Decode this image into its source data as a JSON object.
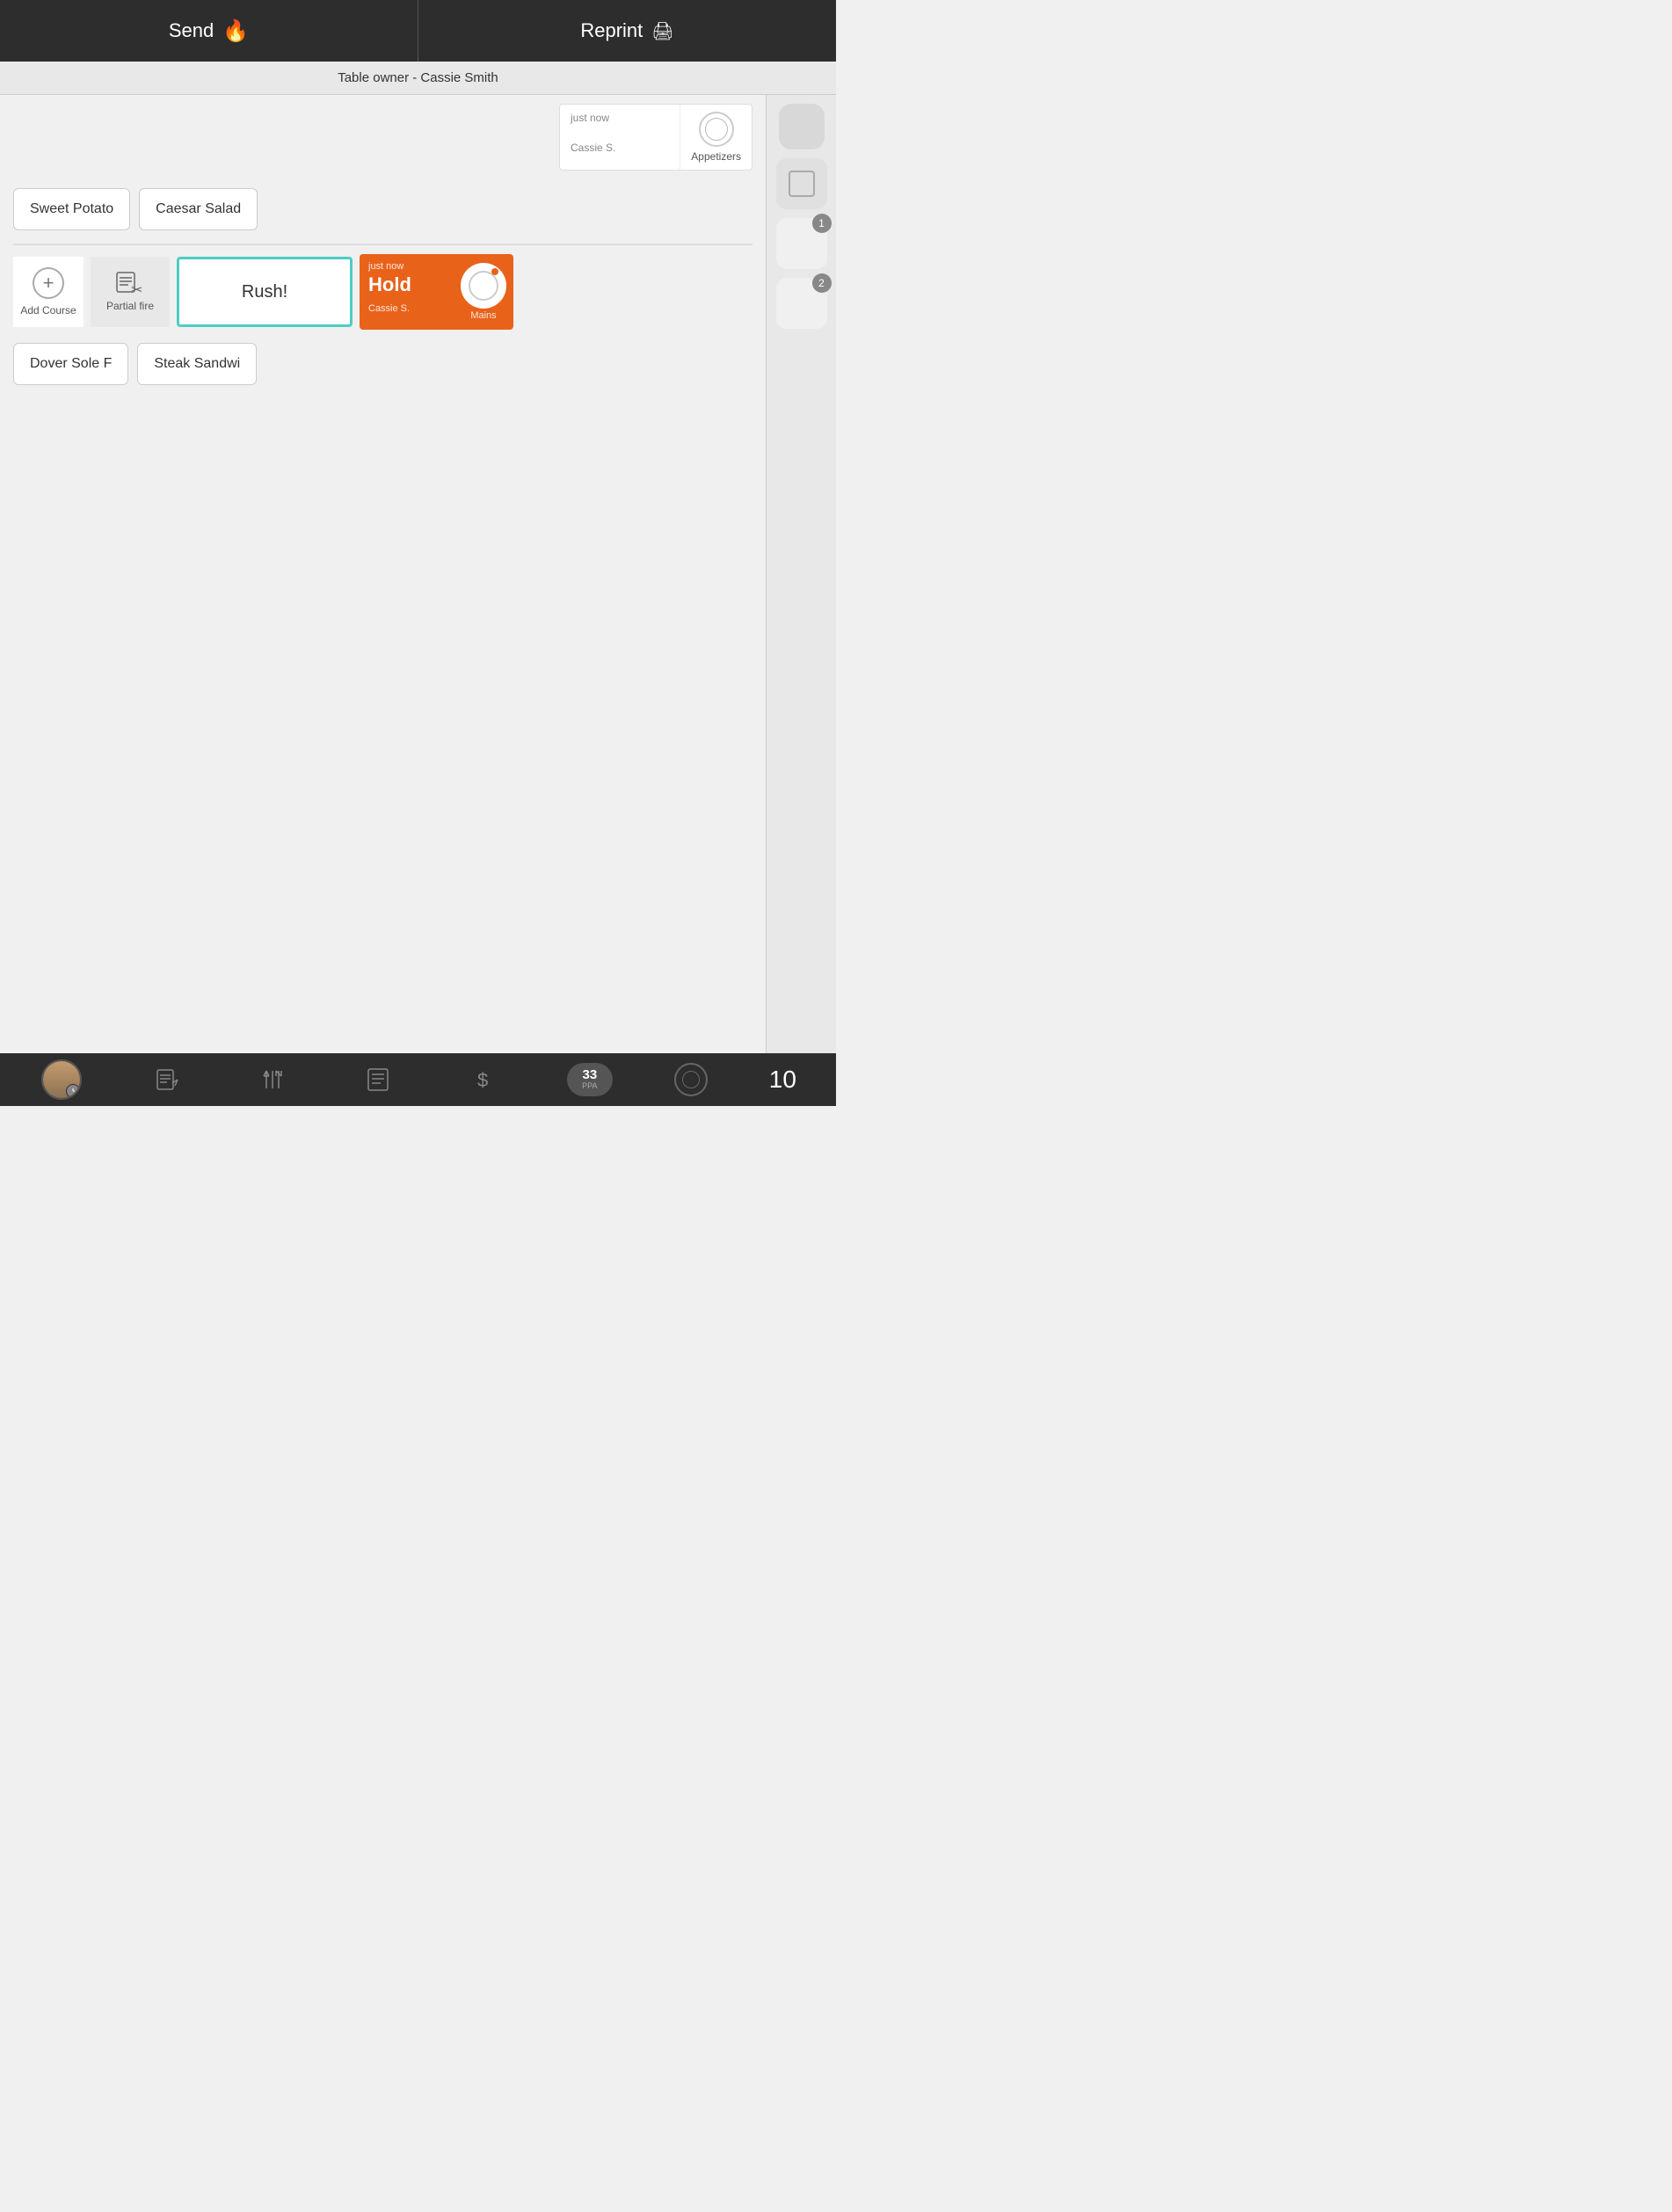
{
  "header": {
    "send_label": "Send",
    "reprint_label": "Reprint",
    "table_owner": "Table owner - Cassie Smith"
  },
  "appetizer_ticket": {
    "time": "just now",
    "server": "Cassie S.",
    "course": "Appetizers"
  },
  "course1": {
    "item1": "Sweet Potato",
    "item2": "Caesar Salad"
  },
  "course2": {
    "add_course_label": "Add Course",
    "partial_fire_label": "Partial fire",
    "rush_label": "Rush!"
  },
  "hold_ticket": {
    "time": "just now",
    "status": "Hold",
    "server": "Cassie S.",
    "course": "Mains"
  },
  "course3": {
    "item1": "Dover Sole F",
    "item2": "Steak Sandwi"
  },
  "sidebar": {
    "badge1": "1",
    "badge2": "2"
  },
  "bottom_bar": {
    "ppa_value": "33",
    "ppa_label": "PPA",
    "table_number": "10"
  }
}
